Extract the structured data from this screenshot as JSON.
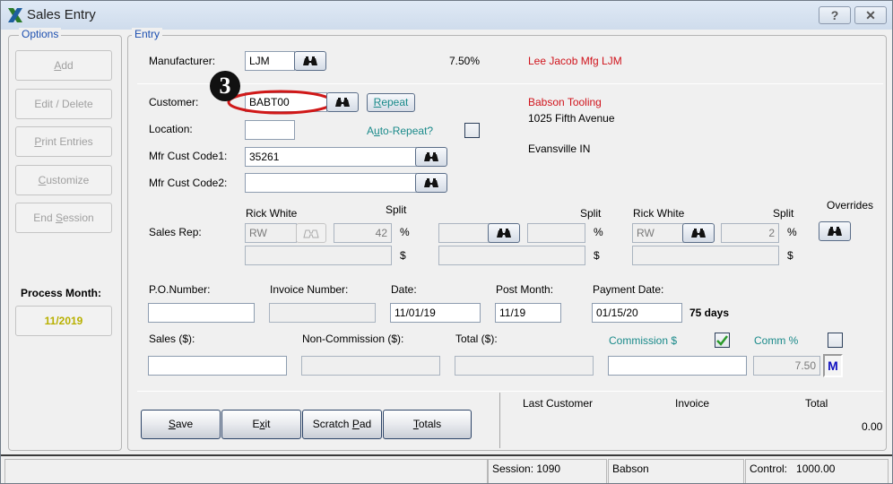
{
  "window": {
    "title": "Sales Entry",
    "help_label": "?",
    "close_label": "✕"
  },
  "options": {
    "group_label": "Options",
    "buttons": [
      {
        "label_pre": "",
        "accel": "A",
        "label_post": "dd"
      },
      {
        "label_pre": "Edit / Delete",
        "accel": "",
        "label_post": ""
      },
      {
        "label_pre": "",
        "accel": "P",
        "label_post": "rint Entries"
      },
      {
        "label_pre": "",
        "accel": "C",
        "label_post": "ustomize"
      },
      {
        "label_pre": "End ",
        "accel": "S",
        "label_post": "ession"
      }
    ],
    "process_month_label": "Process Month:",
    "process_month_value": "11/2019",
    "process_month_color": "#b8b000"
  },
  "entry": {
    "group_label": "Entry",
    "manufacturer_label": "Manufacturer:",
    "manufacturer_value": "LJM",
    "manufacturer_rate": "7.50%",
    "manufacturer_name": "Lee Jacob Mfg  LJM",
    "callout_number": "3",
    "customer_label": "Customer:",
    "customer_value": "BABT00",
    "repeat_label_accel": "R",
    "repeat_label_rest": "epeat",
    "location_label": "Location:",
    "location_value": "",
    "auto_repeat_pre": "A",
    "auto_repeat_accel": "u",
    "auto_repeat_post": "to-Repeat?",
    "auto_repeat_checked": false,
    "customer_name": "Babson Tooling",
    "customer_address1": "1025 Fifth Avenue",
    "customer_address2": "Evansville IN",
    "mfr_cust_code1_label": "Mfr Cust Code1:",
    "mfr_cust_code1_value": "35261",
    "mfr_cust_code2_label": "Mfr Cust Code2:",
    "mfr_cust_code2_value": "",
    "sales_rep_label": "Sales Rep:",
    "split_label": "Split",
    "percent_sign": "%",
    "dollar_sign": "$",
    "overrides_label": "Overrides",
    "reps": [
      {
        "name": "Rick White",
        "code": "RW",
        "split": "42",
        "amount": ""
      },
      {
        "name": "",
        "code": "",
        "split": "",
        "amount": ""
      },
      {
        "name": "Rick White",
        "code": "RW",
        "split": "2",
        "amount": ""
      }
    ],
    "po_number_label": "P.O.Number:",
    "po_number_value": "",
    "invoice_number_label": "Invoice Number:",
    "invoice_number_value": "",
    "date_label": "Date:",
    "date_value": "11/01/19",
    "post_month_label": "Post Month:",
    "post_month_value": "11/19",
    "payment_date_label": "Payment Date:",
    "payment_date_value": "01/15/20",
    "payment_days": "75  days",
    "sales_label": "Sales ($):",
    "sales_value": "",
    "noncommission_label": "Non-Commission ($):",
    "noncommission_value": "",
    "total_label": "Total ($):",
    "total_value": "",
    "commission_dollar_label": "Commission $",
    "commission_dollar_checked": true,
    "commission_dollar_value": "",
    "comm_percent_label": "Comm %",
    "comm_percent_checked": false,
    "comm_percent_value": "7.50",
    "m_button_label": "M"
  },
  "actions": {
    "save_accel": "S",
    "save_rest": "ave",
    "exit_pre": "E",
    "exit_accel": "x",
    "exit_post": "it",
    "scratch_pre": "Scratch ",
    "scratch_accel": "P",
    "scratch_post": "ad",
    "totals_accel": "T",
    "totals_rest": "otals"
  },
  "last_entry": {
    "col_customer": "Last Customer",
    "col_invoice": "Invoice",
    "col_total": "Total",
    "customer": "",
    "invoice": "",
    "total": "0.00"
  },
  "status_bar": {
    "session": "Session: 1090",
    "user": "Babson",
    "control_label": "Control:",
    "control_value": "1000.00"
  }
}
